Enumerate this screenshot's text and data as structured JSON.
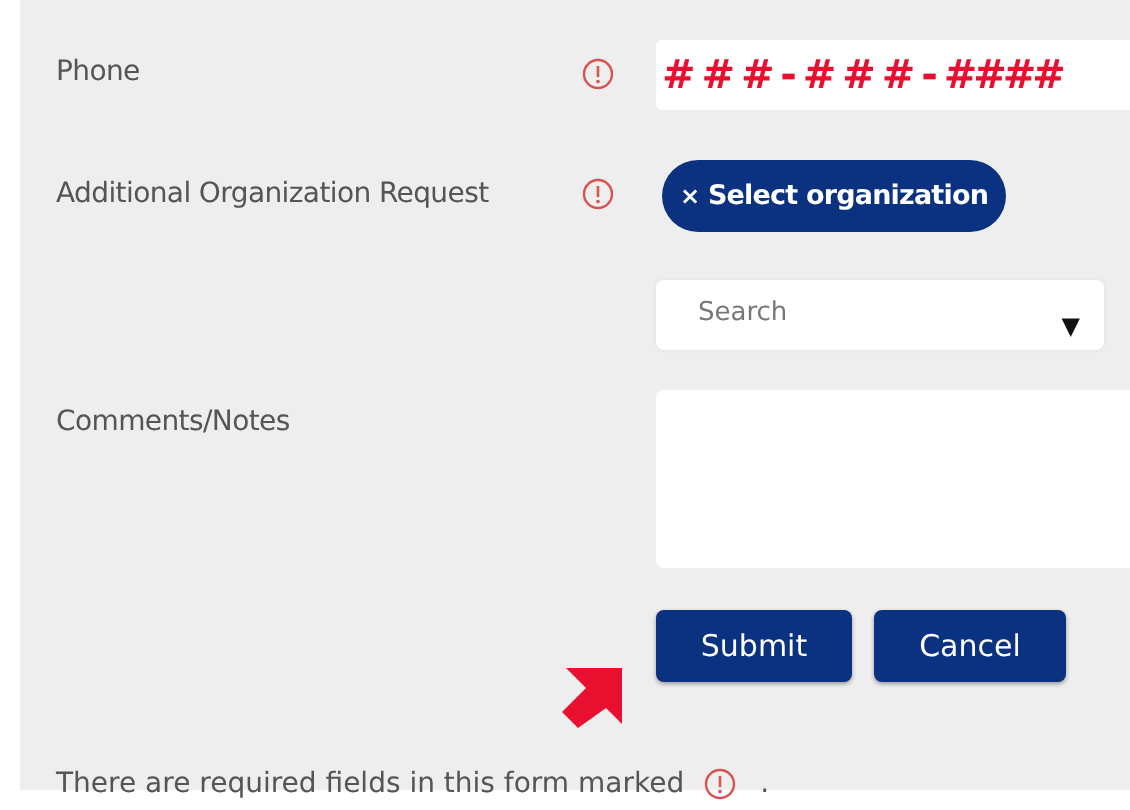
{
  "fields": [
    {
      "kind": "phone",
      "label": "Phone",
      "required": true,
      "value": "# # # - # # # - ####"
    },
    {
      "kind": "tag",
      "label": "Additional Organization Request",
      "required": true,
      "tag": "Select organization",
      "remove": "×"
    },
    {
      "kind": "dropdown",
      "placeholder": "Search",
      "caret": "▼"
    },
    {
      "kind": "textarea",
      "label": "Comments/Notes",
      "required": false
    }
  ],
  "buttons": [
    "Submit",
    "Cancel"
  ],
  "footer": {
    "text": "There are required fields in this form marked",
    "end": "."
  }
}
